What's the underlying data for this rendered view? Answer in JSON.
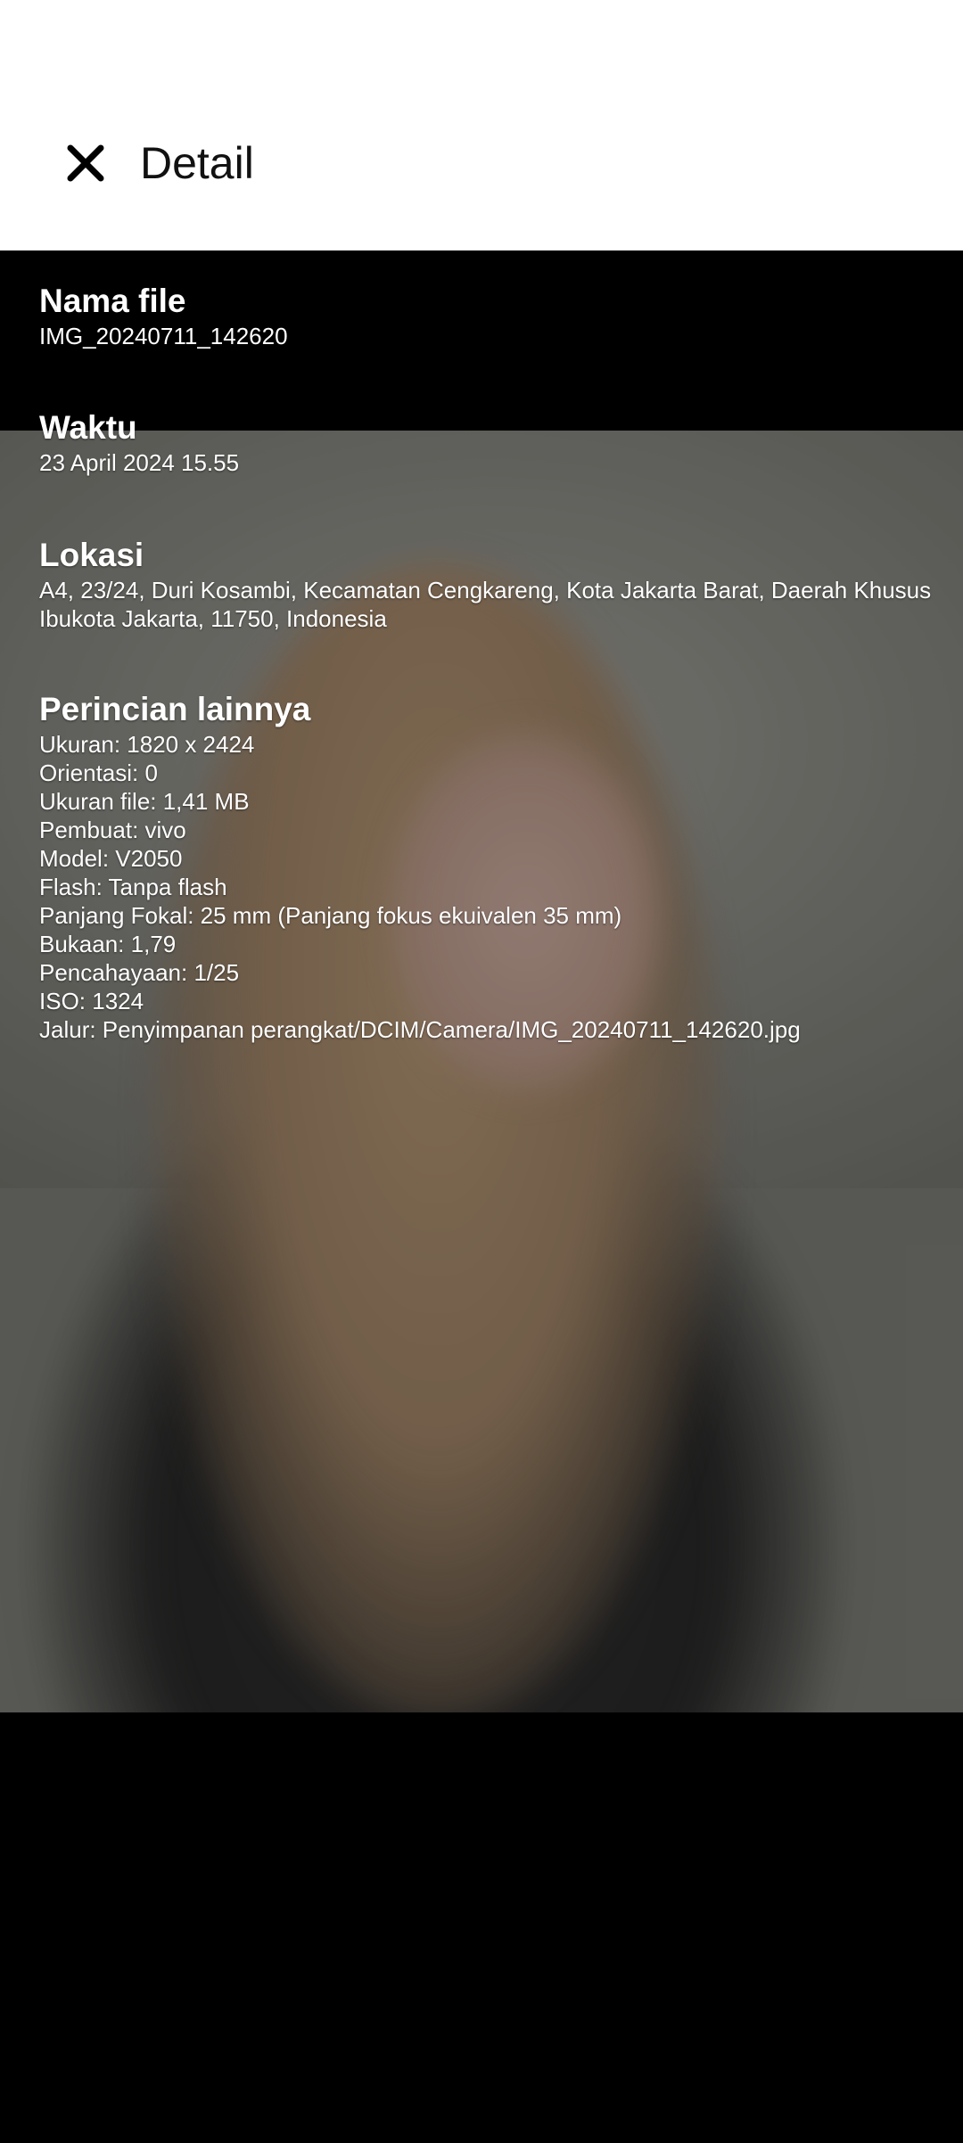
{
  "header": {
    "title": "Detail",
    "close_icon": "close-icon"
  },
  "sections": {
    "file_name": {
      "label": "Nama file",
      "value": "IMG_20240711_142620"
    },
    "time": {
      "label": "Waktu",
      "value": "23 April 2024 15.55"
    },
    "location": {
      "label": "Lokasi",
      "value": "A4, 23/24, Duri Kosambi, Kecamatan Cengkareng, Kota Jakarta Barat, Daerah Khusus Ibukota Jakarta, 11750, Indonesia"
    },
    "other_details": {
      "label": "Perincian lainnya",
      "lines": [
        "Ukuran: 1820 x 2424",
        "Orientasi: 0",
        "Ukuran file: 1,41 MB",
        "Pembuat: vivo",
        "Model: V2050",
        "Flash: Tanpa flash",
        "Panjang Fokal: 25 mm (Panjang fokus ekuivalen 35 mm)",
        "Bukaan: 1,79",
        "Pencahayaan: 1/25",
        "ISO: 1324",
        "Jalur: Penyimpanan perangkat/DCIM/Camera/IMG_20240711_142620.jpg"
      ]
    }
  }
}
